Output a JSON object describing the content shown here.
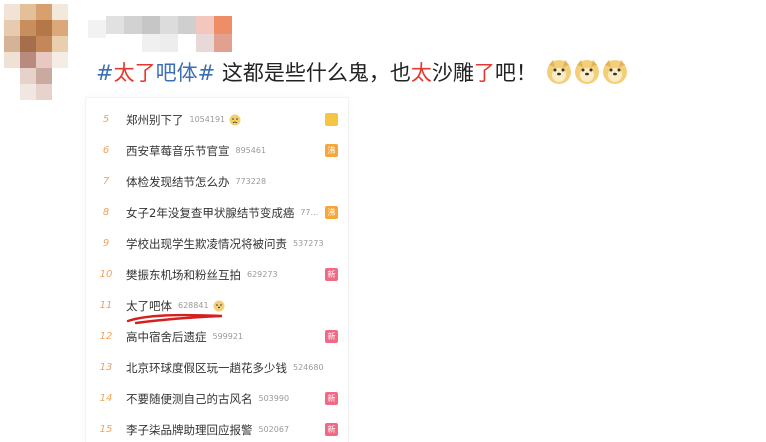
{
  "post": {
    "topic_hash_open": "#",
    "topic_word_red": "太了",
    "topic_word_rest": "吧体",
    "topic_hash_close": "#",
    "text_part1": " 这都是些什么鬼，也",
    "text_red1": "太",
    "text_part2": "沙雕",
    "text_red2": "了",
    "text_part3": "吧！",
    "emoji": [
      "doge-emoji",
      "doge-emoji",
      "doge-emoji"
    ]
  },
  "hot_search": [
    {
      "rank": "5",
      "title": "郑州别下了",
      "count": "1054191",
      "icon": "sad-face-emoji",
      "badge": ""
    },
    {
      "rank": "6",
      "title": "西安草莓音乐节官宣",
      "count": "895461",
      "badge": "沸",
      "badge_type": "hot"
    },
    {
      "rank": "7",
      "title": "体检发现结节怎么办",
      "count": "773228",
      "badge": ""
    },
    {
      "rank": "8",
      "title": "女子2年没复查甲状腺结节变成癌",
      "count": "77...",
      "badge": "沸",
      "badge_type": "hot"
    },
    {
      "rank": "9",
      "title": "学校出现学生欺凌情况将被问责",
      "count": "537273",
      "badge": ""
    },
    {
      "rank": "10",
      "title": "樊振东机场和粉丝互拍",
      "count": "629273",
      "badge": "新",
      "badge_type": "new"
    },
    {
      "rank": "11",
      "title": "太了吧体",
      "count": "628841",
      "icon": "doge-emoji",
      "badge": ""
    },
    {
      "rank": "12",
      "title": "高中宿舍后遗症",
      "count": "599921",
      "badge": "新",
      "badge_type": "new"
    },
    {
      "rank": "13",
      "title": "北京环球度假区玩一趟花多少钱",
      "count": "524680",
      "badge": ""
    },
    {
      "rank": "14",
      "title": "不要随便测自己的古风名",
      "count": "503990",
      "badge": "新",
      "badge_type": "new"
    },
    {
      "rank": "15",
      "title": "李子柒品牌助理回应报警",
      "count": "502067",
      "badge": "新",
      "badge_type": "new"
    }
  ],
  "colors": {
    "topic": "#3b6fb6",
    "highlight": "#e3392f",
    "rank": "#f0a35e",
    "underline": "#d62020"
  }
}
